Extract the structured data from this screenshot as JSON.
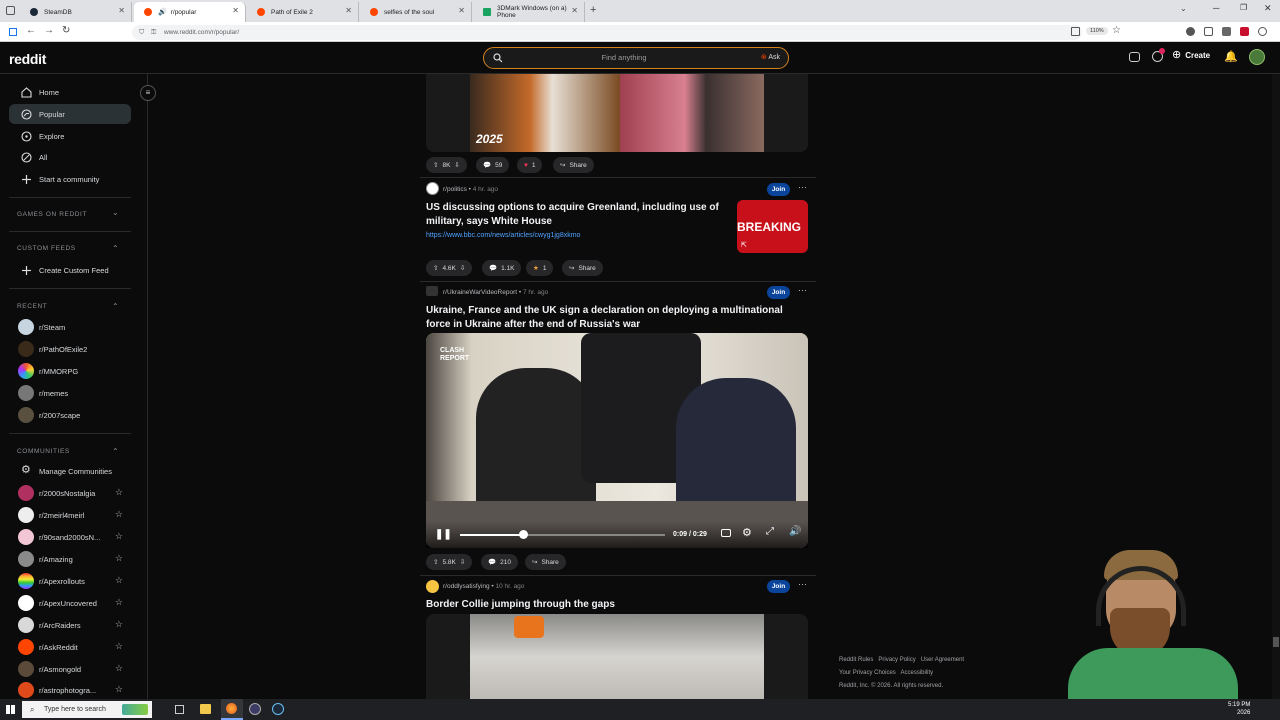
{
  "browser": {
    "tabs": [
      {
        "label": "SteamDB",
        "active": false
      },
      {
        "label": "r/popular",
        "active": true
      },
      {
        "label": "Path of Exile 2",
        "active": false
      },
      {
        "label": "selfies of the soul",
        "active": false
      },
      {
        "label": "3DMark Windows (on a) Phone",
        "active": false
      }
    ],
    "url": "www.reddit.com/r/popular/",
    "zoom": "110%"
  },
  "header": {
    "logo": "reddit",
    "search_placeholder": "Find anything",
    "ask_label": "Ask",
    "create_label": "Create"
  },
  "sidebar": {
    "nav": [
      {
        "label": "Home",
        "icon": "home-icon"
      },
      {
        "label": "Popular",
        "icon": "popular-icon",
        "selected": true
      },
      {
        "label": "Explore",
        "icon": "explore-icon"
      },
      {
        "label": "All",
        "icon": "all-icon"
      },
      {
        "label": "Start a community",
        "icon": "plus-icon"
      }
    ],
    "games_heading": "GAMES ON REDDIT",
    "custom_feeds_heading": "CUSTOM FEEDS",
    "create_custom_feed": "Create Custom Feed",
    "recent_heading": "RECENT",
    "recent": [
      "r/Steam",
      "r/PathOfExile2",
      "r/MMORPG",
      "r/memes",
      "r/2007scape"
    ],
    "communities_heading": "COMMUNITIES",
    "manage_communities": "Manage Communities",
    "communities": [
      "r/2000sNostalgia",
      "r/2meirl4meirl",
      "r/90sand2000sN...",
      "r/Amazing",
      "r/Apexrollouts",
      "r/ApexUncovered",
      "r/ArcRaiders",
      "r/AskReddit",
      "r/Asmongold",
      "r/astrophotogra..."
    ]
  },
  "feed": {
    "post0": {
      "overlay_text": "2025",
      "votes": "8K",
      "comments": "59",
      "awards": "1",
      "share": "Share"
    },
    "post1": {
      "subreddit": "r/politics",
      "ago": "4 hr. ago",
      "join": "Join",
      "title": "US discussing options to acquire Greenland, including use of military, says White House",
      "link": "https://www.bbc.com/news/articles/cwyg1jg8xkmo",
      "thumb_text": "BREAKING",
      "votes": "4.6K",
      "comments": "1.1K",
      "awards": "1",
      "share": "Share"
    },
    "post2": {
      "subreddit": "r/UkraineWarVideoReport",
      "ago": "7 hr. ago",
      "join": "Join",
      "title": "Ukraine, France and the UK sign a declaration on deploying a multinational force in Ukraine after the end of Russia's war",
      "video_watermark": "CLASH REPORT",
      "video_time": "0:09 / 0:29",
      "video_progress": 0.31,
      "votes": "5.8K",
      "comments": "210",
      "share": "Share"
    },
    "post3": {
      "subreddit": "r/oddlysatisfying",
      "ago": "10 hr. ago",
      "join": "Join",
      "title": "Border Collie jumping through the gaps"
    }
  },
  "footer": {
    "links_row1": [
      "Reddit Rules",
      "Privacy Policy",
      "User Agreement"
    ],
    "links_row2": [
      "Your Privacy Choices",
      "Accessibility"
    ],
    "copyright": "Reddit, Inc. © 2026. All rights reserved."
  },
  "taskbar": {
    "search_placeholder": "Type here to search",
    "time": "5:19 PM",
    "date": "2026"
  },
  "colors": {
    "accent_orange": "#d4831a",
    "join_blue": "#0a449b",
    "link_blue": "#4fa3ff",
    "breaking_red": "#c8101a"
  }
}
